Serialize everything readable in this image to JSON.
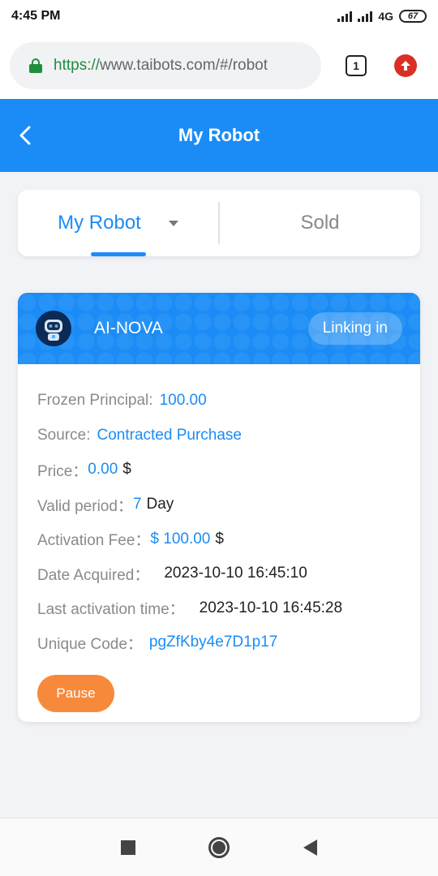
{
  "status_bar": {
    "time": "4:45 PM",
    "network": "4G",
    "battery": "67"
  },
  "browser": {
    "url_scheme": "https://",
    "url_rest": "www.taibots.com/#/robot",
    "tab_count": "1",
    "icons": {
      "lock": "lock-icon",
      "update": "upload-icon"
    }
  },
  "header": {
    "title": "My Robot",
    "back_icon": "chevron-left-icon"
  },
  "tabs": [
    {
      "label": "My Robot",
      "active": true
    },
    {
      "label": "Sold",
      "active": false
    }
  ],
  "robot": {
    "name": "AI-NOVA",
    "status": "Linking in",
    "rows": {
      "frozen_principal": {
        "label": "Frozen Principal: ",
        "value": "100.00"
      },
      "source": {
        "label": "Source: ",
        "value": "Contracted Purchase"
      },
      "price": {
        "label": "Price：",
        "value": "0.00",
        "unit": "$"
      },
      "valid_period": {
        "label": "Valid period：",
        "value": "7",
        "unit": "Day"
      },
      "activation_fee": {
        "label": "Activation Fee：",
        "value": "$ 100.00",
        "unit": "$"
      },
      "date_acquired": {
        "label": "Date Acquired：",
        "value": "2023-10-10 16:45:10"
      },
      "last_activation": {
        "label": "Last activation time：",
        "value": "2023-10-10 16:45:28"
      },
      "unique_code": {
        "label": "Unique Code：",
        "value": "pgZfKby4e7D1p17"
      }
    },
    "pause_label": "Pause"
  },
  "colors": {
    "primary": "#1b8cf5",
    "accent": "#f7893b",
    "secure": "#1e8e3e"
  }
}
